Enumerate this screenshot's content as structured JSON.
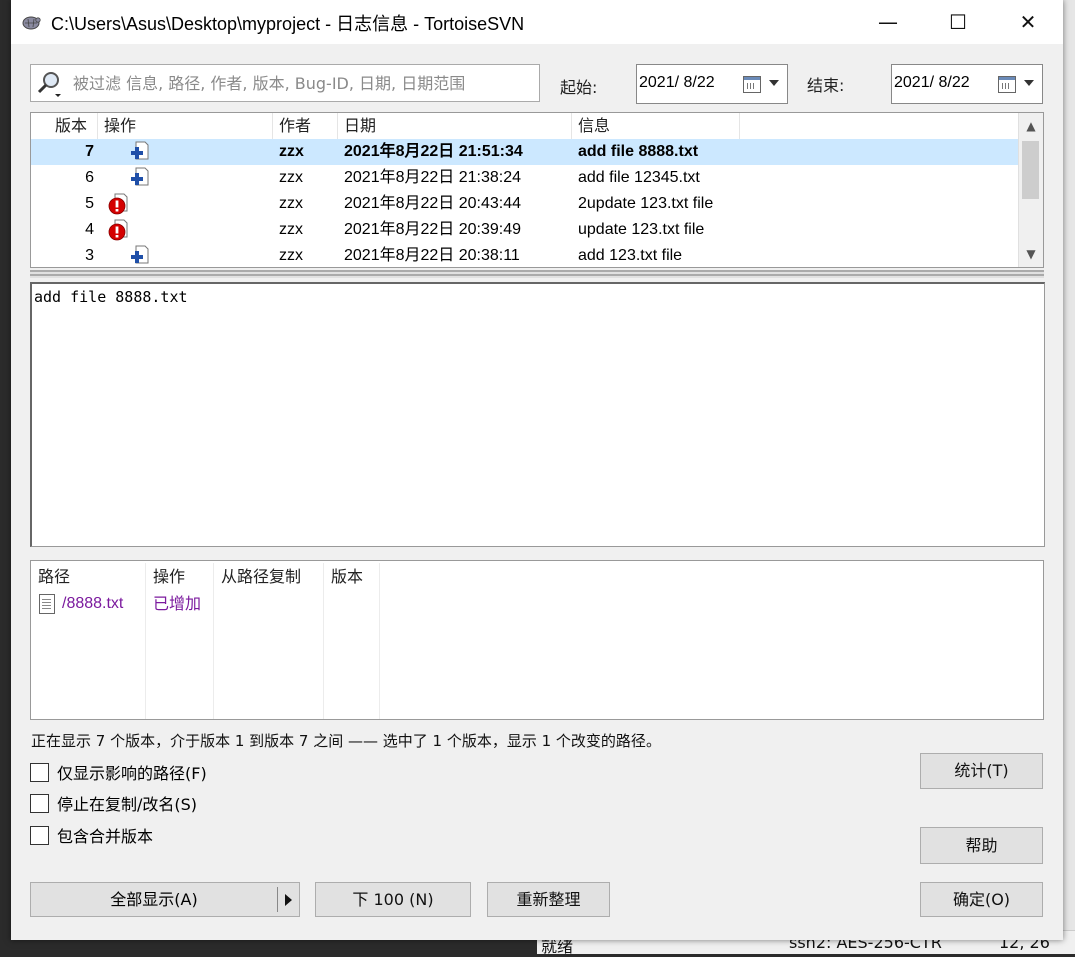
{
  "window": {
    "title": "C:\\Users\\Asus\\Desktop\\myproject - 日志信息 - TortoiseSVN",
    "minimize": "—",
    "maximize": "☐",
    "close": "✕"
  },
  "filter": {
    "placeholder": "被过滤 信息, 路径, 作者, 版本, Bug-ID, 日期, 日期范围",
    "start_label": "起始:",
    "start_value": "2021/  8/22",
    "end_label": "结束:",
    "end_value": "2021/  8/22"
  },
  "revlist": {
    "headers": {
      "rev": "版本",
      "action": "操作",
      "author": "作者",
      "date": "日期",
      "message": "信息"
    },
    "rows": [
      {
        "rev": "7",
        "action": "add",
        "author": "zzx",
        "date": "2021年8月22日 21:51:34",
        "message": "add file 8888.txt",
        "selected": true
      },
      {
        "rev": "6",
        "action": "add",
        "author": "zzx",
        "date": "2021年8月22日 21:38:24",
        "message": "add file 12345.txt",
        "selected": false
      },
      {
        "rev": "5",
        "action": "modify",
        "author": "zzx",
        "date": "2021年8月22日 20:43:44",
        "message": "2update 123.txt file",
        "selected": false
      },
      {
        "rev": "4",
        "action": "modify",
        "author": "zzx",
        "date": "2021年8月22日 20:39:49",
        "message": "update 123.txt file",
        "selected": false
      },
      {
        "rev": "3",
        "action": "add",
        "author": "zzx",
        "date": "2021年8月22日 20:38:11",
        "message": "add 123.txt file",
        "selected": false
      }
    ]
  },
  "message_text": "add file 8888.txt",
  "pathlist": {
    "headers": {
      "path": "路径",
      "action": "操作",
      "copyfrom": "从路径复制",
      "rev": "版本"
    },
    "rows": [
      {
        "path": "/8888.txt",
        "action": "已增加"
      }
    ]
  },
  "status_text": "正在显示 7 个版本，介于版本 1 到版本 7 之间 —— 选中了 1 个版本，显示 1 个改变的路径。",
  "checkboxes": {
    "affected_only": "仅显示影响的路径(F)",
    "stop_on_copy": "停止在复制/改名(S)",
    "include_merged": "包含合并版本"
  },
  "buttons": {
    "stats": "统计(T)",
    "help": "帮助",
    "show_all": "全部显示(A)",
    "next100": "下 100 (N)",
    "refresh": "重新整理",
    "ok": "确定(O)"
  },
  "background_app": {
    "status_left": "就绪",
    "status_mid": "ssh2: AES-256-CTR",
    "status_right": "12,  26"
  },
  "colors": {
    "selected_row": "#cce8ff",
    "added_path": "#7b1a9e",
    "add_icon": "#1f4fa8",
    "modify_icon": "#d40000"
  }
}
